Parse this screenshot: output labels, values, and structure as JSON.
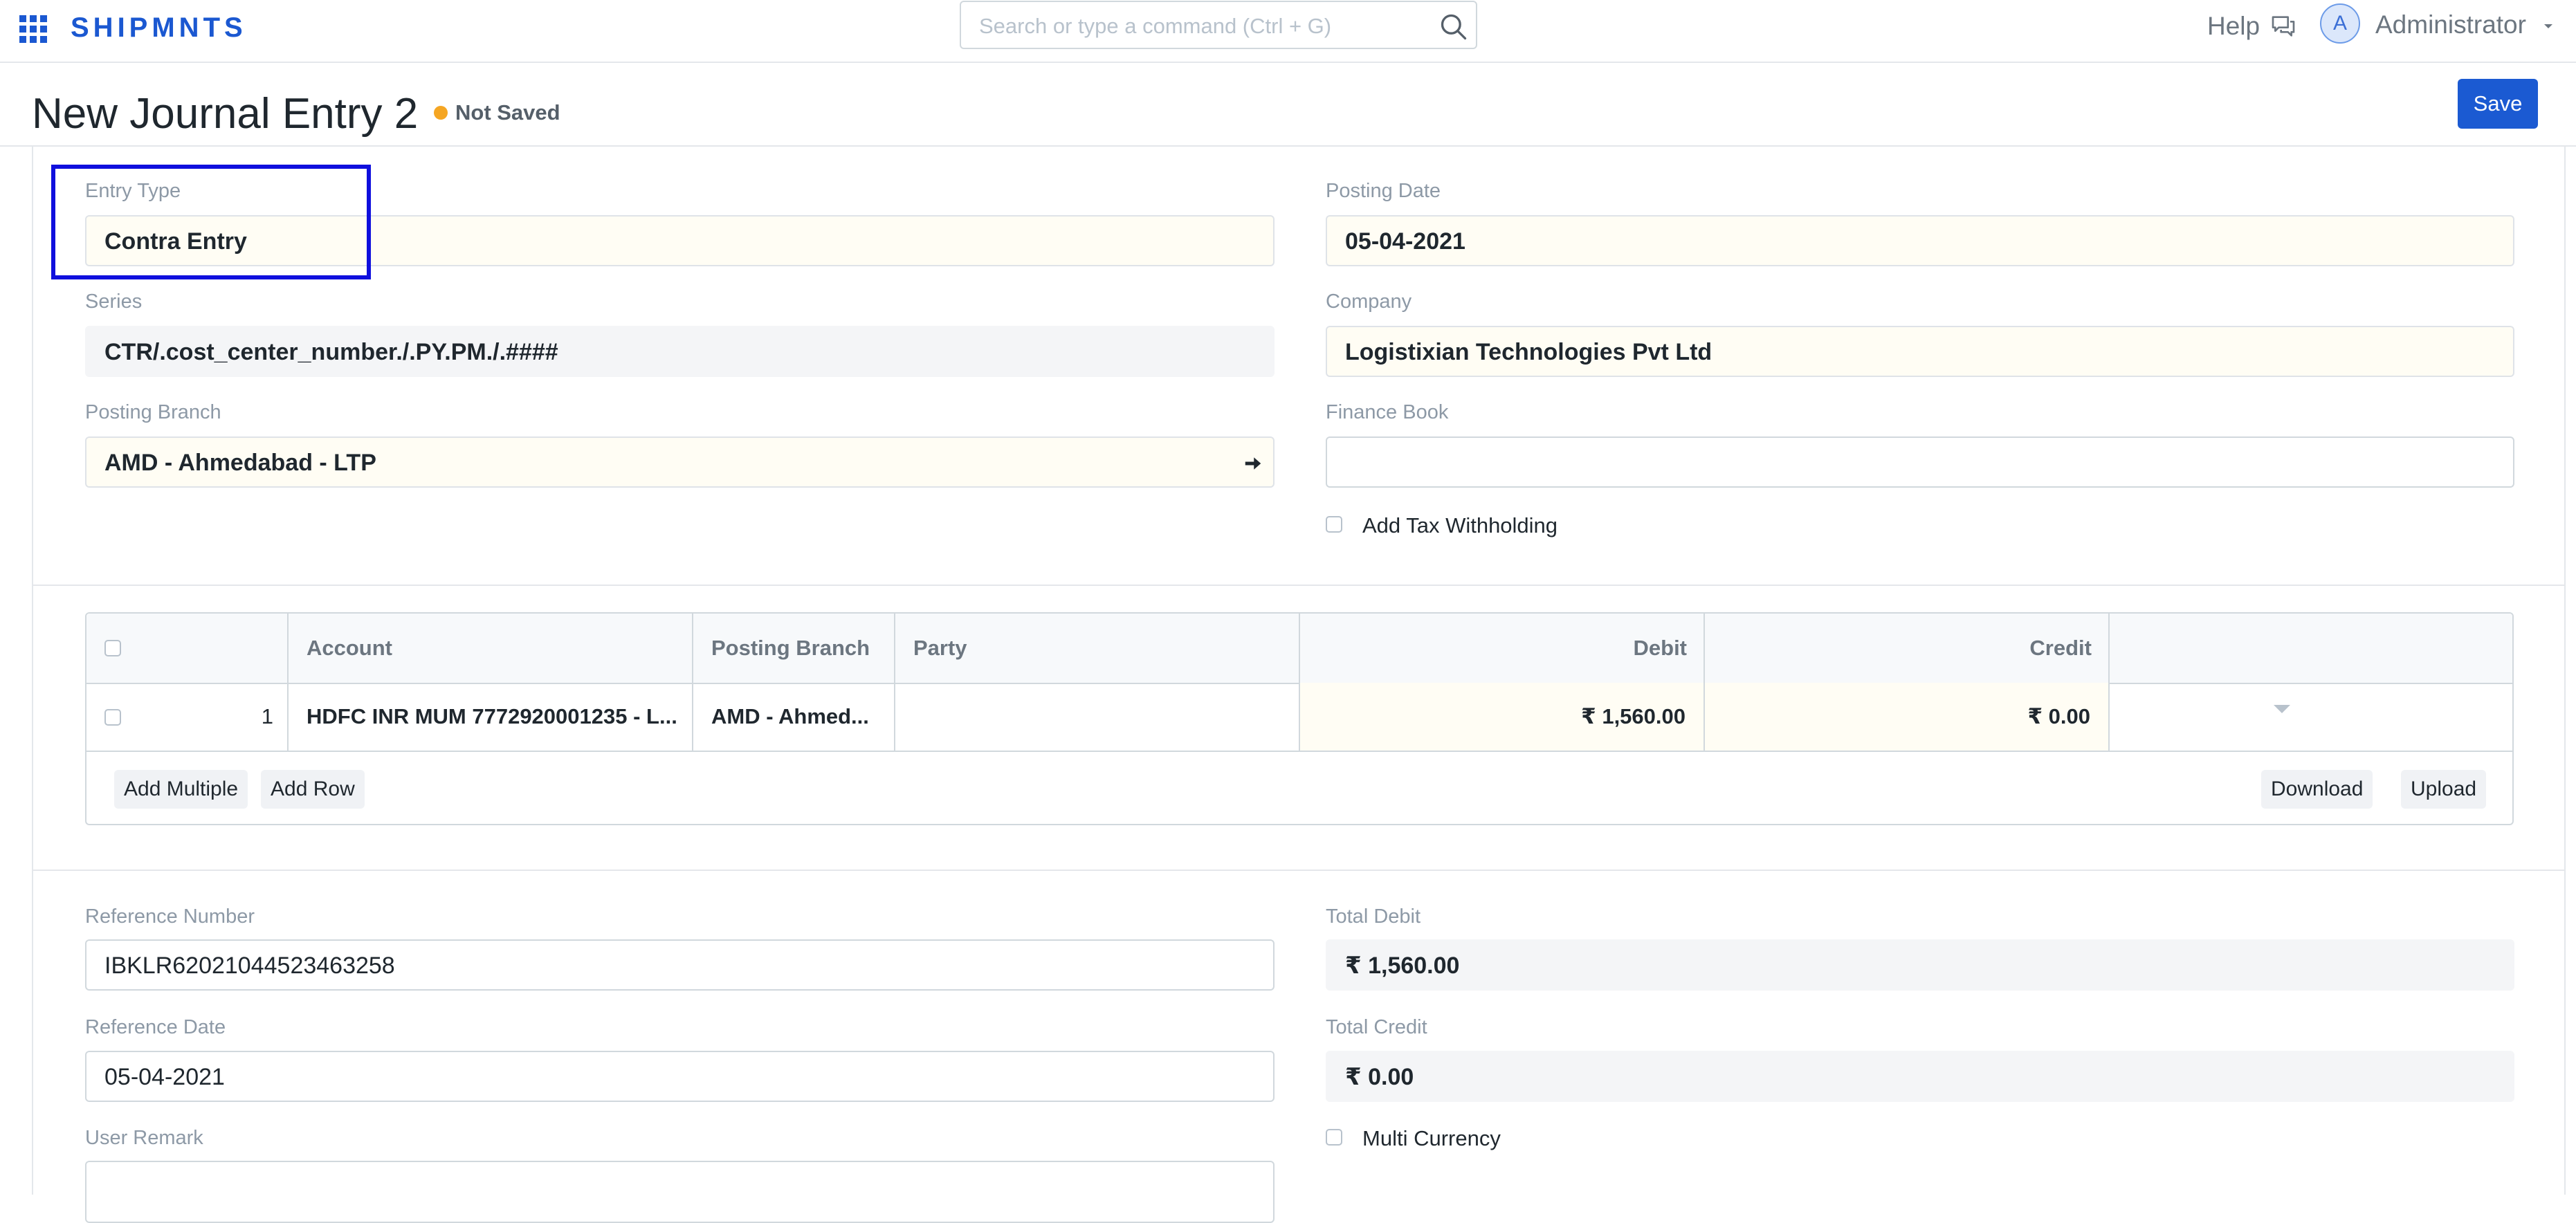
{
  "navbar": {
    "brand": "SHIPMNTS",
    "search_placeholder": "Search or type a command (Ctrl + G)",
    "help_label": "Help",
    "avatar_initial": "A",
    "user_label": "Administrator"
  },
  "page": {
    "title": "New Journal Entry 2",
    "status": "Not Saved",
    "save_label": "Save"
  },
  "form": {
    "entry_type": {
      "label": "Entry Type",
      "value": "Contra Entry"
    },
    "posting_date": {
      "label": "Posting Date",
      "value": "05-04-2021"
    },
    "series": {
      "label": "Series",
      "value": "CTR/.cost_center_number./.PY.PM./.####"
    },
    "company": {
      "label": "Company",
      "value": "Logistixian Technologies Pvt Ltd"
    },
    "posting_branch": {
      "label": "Posting Branch",
      "value": "AMD - Ahmedabad - LTP"
    },
    "finance_book": {
      "label": "Finance Book",
      "value": ""
    },
    "add_tax_withholding": {
      "label": "Add Tax Withholding",
      "checked": false
    }
  },
  "accounts_table": {
    "columns": [
      "Account",
      "Posting Branch",
      "Party",
      "Debit",
      "Credit"
    ],
    "rows": [
      {
        "idx": "1",
        "account": "HDFC INR MUM 7772920001235 - L...",
        "posting_branch": "AMD - Ahmed...",
        "party": "",
        "debit": "₹ 1,560.00",
        "credit": "₹ 0.00"
      }
    ],
    "buttons": {
      "add_multiple": "Add Multiple",
      "add_row": "Add Row",
      "download": "Download",
      "upload": "Upload"
    }
  },
  "references": {
    "reference_number": {
      "label": "Reference Number",
      "value": "IBKLR62021044523463258"
    },
    "total_debit": {
      "label": "Total Debit",
      "value": "₹ 1,560.00"
    },
    "reference_date": {
      "label": "Reference Date",
      "value": "05-04-2021"
    },
    "total_credit": {
      "label": "Total Credit",
      "value": "₹ 0.00"
    },
    "user_remark": {
      "label": "User Remark",
      "value": ""
    },
    "multi_currency": {
      "label": "Multi Currency",
      "checked": false
    }
  },
  "colors": {
    "brand": "#1b58d1",
    "primary_button": "#1b5ad2",
    "status_indicator": "#f5a623",
    "highlight_box": "#0f0fdd"
  }
}
